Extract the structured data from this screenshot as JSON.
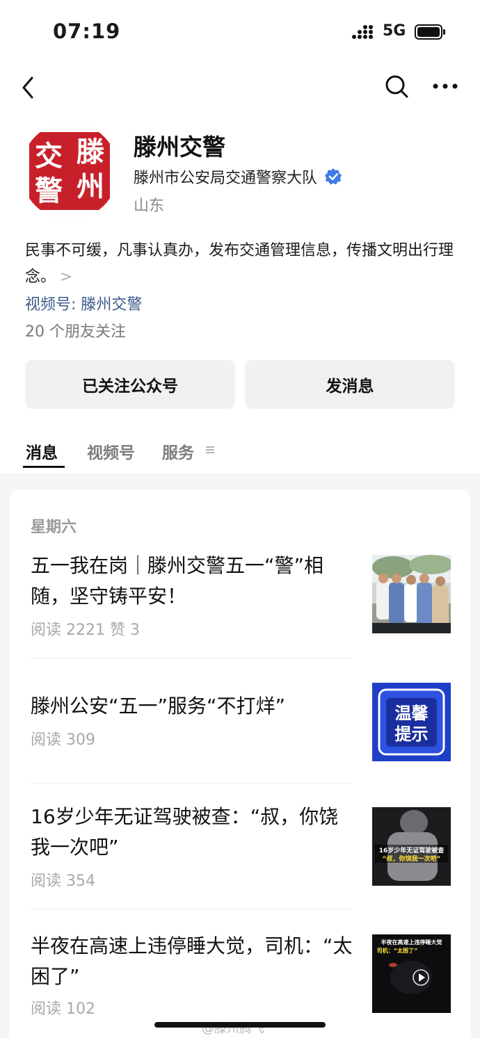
{
  "status_bar": {
    "time": "07:19",
    "network": "5G"
  },
  "account": {
    "name": "滕州交警",
    "avatar_text": "滕州交警",
    "organization": "滕州市公安局交通警察大队",
    "region": "山东",
    "description": "民事不可缓，凡事认真办，发布交通管理信息，传播文明出行理念。",
    "description_more": ">",
    "channel": "视频号: 滕州交警",
    "friends_following": "20 个朋友关注"
  },
  "actions": {
    "follow_label": "已关注公众号",
    "message_label": "发消息"
  },
  "tabs": [
    {
      "label": "消息",
      "active": true
    },
    {
      "label": "视频号",
      "active": false
    },
    {
      "label": "服务",
      "active": false
    }
  ],
  "feed": {
    "day_label": "星期六",
    "articles": [
      {
        "title": "五一我在岗｜滕州交警五一“警”相随，坚守铸平安！",
        "meta": "阅读 2221  赞 3"
      },
      {
        "title": "滕州公安“五一”服务“不打烊”",
        "meta": "阅读 309",
        "thumb_text_1": "温馨",
        "thumb_text_2": "提示"
      },
      {
        "title": "16岁少年无证驾驶被查：“叔，你饶我一次吧”",
        "meta": "阅读 354",
        "thumb_caption_1": "16岁少年无证驾驶被查",
        "thumb_caption_2": "“叔，你饶我一次吧”"
      },
      {
        "title": "半夜在高速上违停睡大觉，司机：“太困了”",
        "meta": "阅读 102",
        "thumb_caption_1": "半夜在高速上违停睡大觉",
        "thumb_caption_2": "司机：“太困了”"
      }
    ]
  },
  "watermark": "@滕州腾飞",
  "colors": {
    "accent_link": "#3d5a8a",
    "verified": "#3d7be8",
    "avatar_red": "#c8202a",
    "warm_tip_blue": "#1f3fc8"
  },
  "icons": [
    "back-icon",
    "search-icon",
    "more-icon",
    "verified-icon",
    "menu-lines-icon",
    "play-icon"
  ]
}
